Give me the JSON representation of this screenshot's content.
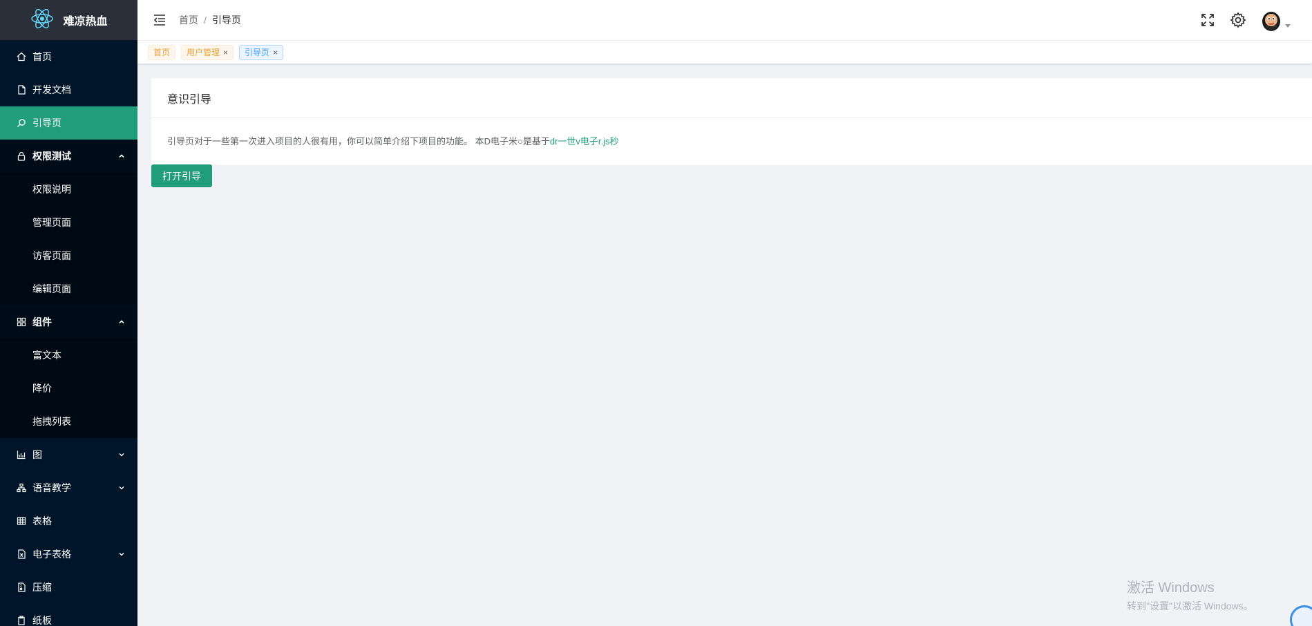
{
  "app": {
    "title": "难凉热血",
    "logo_icon": "react-logo-icon"
  },
  "sidebar": {
    "items": [
      {
        "label": "首页",
        "icon": "home-icon"
      },
      {
        "label": "开发文档",
        "icon": "document-icon"
      },
      {
        "label": "引导页",
        "icon": "search-icon",
        "active": true
      },
      {
        "label": "权限测试",
        "icon": "lock-icon",
        "open": true,
        "children": [
          "权限说明",
          "管理页面",
          "访客页面",
          "编辑页面"
        ]
      },
      {
        "label": "组件",
        "icon": "grid-icon",
        "open": true,
        "children": [
          "富文本",
          "降价",
          "拖拽列表"
        ]
      },
      {
        "label": "图",
        "icon": "chart-icon"
      },
      {
        "label": "语音教学",
        "icon": "sitemap-icon"
      },
      {
        "label": "表格",
        "icon": "table-icon"
      },
      {
        "label": "电子表格",
        "icon": "excel-icon"
      },
      {
        "label": "压缩",
        "icon": "zip-icon"
      },
      {
        "label": "纸板",
        "icon": "clipboard-icon"
      }
    ]
  },
  "header": {
    "breadcrumb": [
      "首页",
      "引导页"
    ],
    "breadcrumb_sep": "/"
  },
  "tags": [
    {
      "label": "首页",
      "closable": false
    },
    {
      "label": "用户管理",
      "closable": true
    },
    {
      "label": "引导页",
      "closable": true,
      "active": true
    }
  ],
  "tag_close": "×",
  "card": {
    "title": "意识引导",
    "text": "引导页对于一些第一次进入项目的人很有用，你可以简单介绍下项目的功能。 本D电子米○是基于",
    "link": "dr一世v电子r.js秒"
  },
  "open_button": "打开引导",
  "watermark": {
    "title": "激活 Windows",
    "subtitle": "转到\"设置\"以激活 Windows。"
  },
  "colors": {
    "accent": "#1f9e79",
    "sidebar_bg": "#001529",
    "warning_tag": "#e6a23c",
    "info_tag": "#409eff"
  }
}
